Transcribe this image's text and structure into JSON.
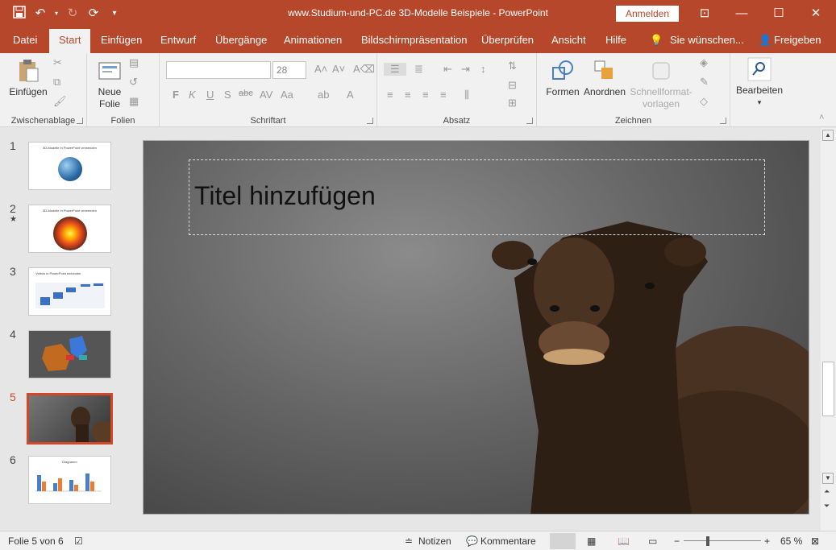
{
  "window": {
    "title": "www.Studium-und-PC.de  3D-Modelle Beispiele  -  PowerPoint",
    "signin": "Anmelden"
  },
  "qat": {
    "save_icon": "save-icon",
    "undo_icon": "undo-icon",
    "redo_icon": "redo-icon",
    "present_icon": "present-from-start-icon",
    "customize_icon": "customize-qat-icon"
  },
  "window_controls": {
    "ribbon_options": "ribbon-display-icon",
    "minimize": "minimize-icon",
    "maximize": "maximize-icon",
    "close": "close-icon"
  },
  "tabs": [
    "Datei",
    "Start",
    "Einfügen",
    "Entwurf",
    "Übergänge",
    "Animationen",
    "Bildschirmpräsentation",
    "Überprüfen",
    "Ansicht",
    "Hilfe"
  ],
  "tell_me": "Sie wünschen...",
  "share": "Freigeben",
  "ribbon": {
    "clipboard": {
      "paste": "Einfügen",
      "label": "Zwischenablage"
    },
    "slides": {
      "new_slide_1": "Neue",
      "new_slide_2": "Folie",
      "label": "Folien"
    },
    "font": {
      "font_size": "28",
      "label": "Schriftart",
      "bold": "F",
      "italic": "K",
      "underline": "U",
      "shadow": "S",
      "strike": "abc"
    },
    "paragraph": {
      "label": "Absatz"
    },
    "drawing": {
      "shapes": "Formen",
      "arrange": "Anordnen",
      "quick_styles_1": "Schnellformat-",
      "quick_styles_2": "vorlagen",
      "label": "Zeichnen"
    },
    "editing": {
      "label": "Bearbeiten"
    }
  },
  "slides": [
    {
      "num": "1",
      "title": "3D-Modelle in PowerPoint verwenden"
    },
    {
      "num": "2",
      "title": "3D-Modelle in PowerPoint verwenden",
      "star": "★"
    },
    {
      "num": "3",
      "title": "Videos in PowerPoint einbinden"
    },
    {
      "num": "4",
      "title": ""
    },
    {
      "num": "5",
      "title": ""
    },
    {
      "num": "6",
      "title": "Diagramm"
    }
  ],
  "selected_slide": 5,
  "slide": {
    "title_placeholder": "Titel hinzufügen"
  },
  "status": {
    "slide_of": "Folie 5 von 6",
    "notes": "Notizen",
    "comments": "Kommentare",
    "zoom": "65 %"
  },
  "colors": {
    "accent": "#b7472a",
    "selected": "#d24726"
  }
}
